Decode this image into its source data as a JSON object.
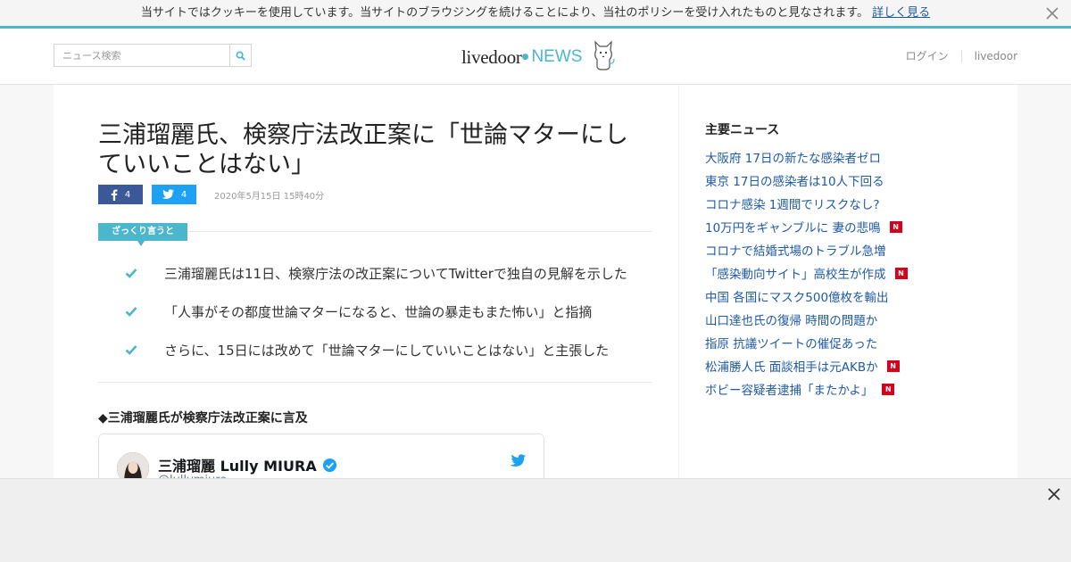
{
  "cookie_bar": {
    "text": "当サイトではクッキーを使用しています。当サイトのブラウジングを続けることにより、当社のポリシーを受け入れたものと見なされます。",
    "link": "詳しく見る",
    "close_icon": "close-icon"
  },
  "header": {
    "search": {
      "placeholder": "ニュース検索",
      "icon": "search-icon"
    },
    "logo": {
      "brand": "livedoor",
      "dot": "●",
      "product": "NEWS",
      "mascot": "dog-mascot-icon"
    },
    "links": [
      "ログイン",
      "livedoor"
    ]
  },
  "article": {
    "title": "三浦瑠麗氏、検察庁法改正案に「世論マターにしていいことはない」",
    "share": {
      "facebook_count": "4",
      "twitter_count": "4",
      "facebook_icon": "facebook-icon",
      "twitter_icon": "twitter-icon"
    },
    "date": "2020年5月15日 15時40分",
    "summary_label": "ざっくり言うと",
    "summary": [
      "三浦瑠麗氏は11日、検察庁法の改正案についてTwitterで独自の見解を示した",
      "「人事がその都度世論マターになると、世論の暴走もまた怖い」と指摘",
      "さらに、15日には改めて「世論マターにしていいことはない」と主張した"
    ],
    "section_heading": "◆三浦瑠麗氏が検察庁法改正案に言及",
    "tweet": {
      "name": "三浦瑠麗 Lully MIURA",
      "handle": "@lullymiura",
      "verified_icon": "verified-badge-icon",
      "bird_icon": "twitter-bird-icon"
    }
  },
  "sidebar": {
    "heading": "主要ニュース",
    "news": [
      {
        "title": "大阪府 17日の新たな感染者ゼロ",
        "badge": ""
      },
      {
        "title": "東京 17日の感染者は10人下回る",
        "badge": ""
      },
      {
        "title": "コロナ感染 1週間でリスクなし?",
        "badge": ""
      },
      {
        "title": "10万円をギャンブルに 妻の悲鳴",
        "badge": "N"
      },
      {
        "title": "コロナで結婚式場のトラブル急増",
        "badge": ""
      },
      {
        "title": "「感染動向サイト」高校生が作成",
        "badge": "N"
      },
      {
        "title": "中国 各国にマスク500億枚を輸出",
        "badge": ""
      },
      {
        "title": "山口達也氏の復帰 時間の問題か",
        "badge": ""
      },
      {
        "title": "指原 抗議ツイートの催促あった",
        "badge": ""
      },
      {
        "title": "松浦勝人氏 面談相手は元AKBか",
        "badge": "N"
      },
      {
        "title": "ボビー容疑者逮捕「またかよ」",
        "badge": "N"
      }
    ]
  },
  "ad_overlay": {
    "close_icon": "close-icon"
  },
  "colors": {
    "accent": "#4bb6cc",
    "link": "#1e5aa8",
    "facebook": "#3b5998",
    "twitter": "#1da1f2",
    "new_badge": "#d4001e"
  }
}
